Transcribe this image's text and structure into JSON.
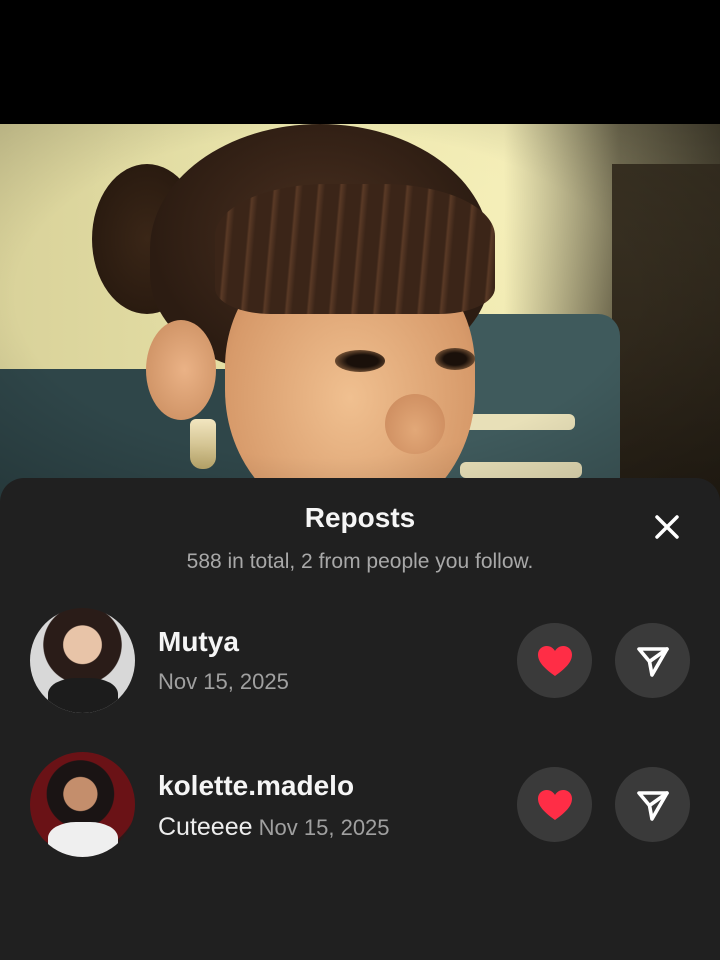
{
  "photo": {
    "alt": "child photo"
  },
  "sheet": {
    "title": "Reposts",
    "subtitle": "588 in total, 2 from people you follow."
  },
  "reposts": [
    {
      "username": "Mutya",
      "caption": "",
      "date": "Nov 15, 2025",
      "liked": true
    },
    {
      "username": "kolette.madelo",
      "caption": "Cuteeee",
      "date": "Nov 15, 2025",
      "liked": true
    }
  ],
  "icons": {
    "close": "close-icon",
    "like": "heart-icon",
    "share": "send-icon"
  },
  "colors": {
    "sheet_bg": "#202020",
    "button_bg": "#3a3a3a",
    "heart": "#ff2d46"
  }
}
